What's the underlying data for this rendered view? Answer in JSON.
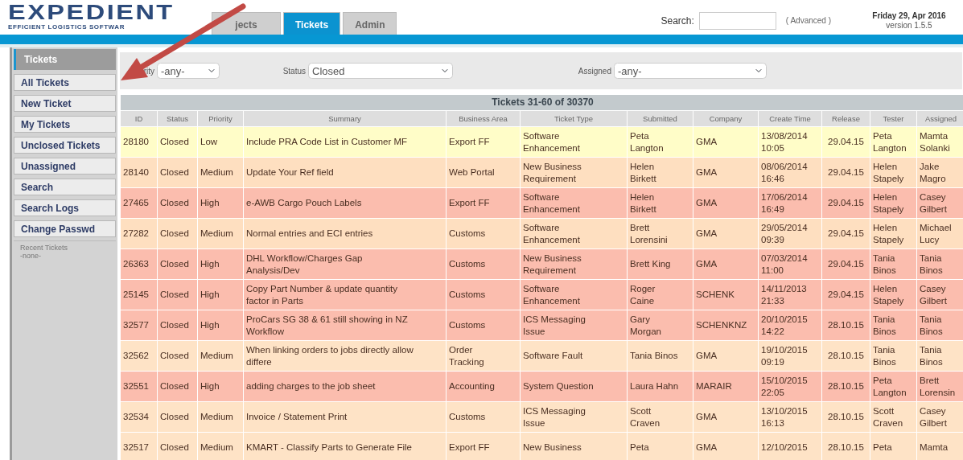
{
  "header": {
    "logo": "EXPEDIENT",
    "tagline": "EFFICIENT LOGISTICS SOFTWAR",
    "tabs": [
      {
        "label": "jects",
        "selected": false
      },
      {
        "label": "Tickets",
        "selected": true
      },
      {
        "label": "Admin",
        "selected": false
      }
    ],
    "search": {
      "label": "Search:",
      "advanced": "( Advanced )"
    },
    "date": "Friday 29, Apr 2016",
    "version": "version 1.5.5"
  },
  "sidebar": {
    "title": "Tickets",
    "items": [
      {
        "label": "All Tickets"
      },
      {
        "label": "New Ticket"
      },
      {
        "label": "My Tickets"
      },
      {
        "label": "Unclosed Tickets"
      },
      {
        "label": "Unassigned"
      },
      {
        "label": "Search"
      },
      {
        "label": "Search Logs"
      },
      {
        "label": "Change Passwd"
      }
    ],
    "recent_title": "Recent Tickets",
    "recent": "-none-"
  },
  "filters": [
    {
      "label": "rity",
      "value": "-any-"
    },
    {
      "label": "Status",
      "value": "Closed"
    },
    {
      "label": "Assigned",
      "value": "-any-"
    }
  ],
  "table": {
    "title": "Tickets 31-60 of 30370",
    "columns": [
      "ID",
      "Status",
      "Priority",
      "Summary",
      "Business Area",
      "Ticket Type",
      "Submitted",
      "Company",
      "Create Time",
      "Release",
      "Tester",
      "Assigned"
    ],
    "rows": [
      {
        "color": "#fffdc8",
        "cells": [
          "28180",
          "Closed",
          "Low",
          "Include PRA Code List in Customer MF",
          "Export FF",
          "Software\nEnhancement",
          "Peta\nLangton",
          "GMA",
          "13/08/2014\n10:05",
          "29.04.15",
          "Peta\nLangton",
          "Mamta\nSolanki"
        ]
      },
      {
        "color": "#fedfc0",
        "cells": [
          "28140",
          "Closed",
          "Medium",
          "Update Your Ref field",
          "Web Portal",
          "New Business\nRequirement",
          "Helen\nBirkett",
          "GMA",
          "08/06/2014\n16:46",
          "29.04.15",
          "Helen\nStapely",
          "Jake\nMagro"
        ]
      },
      {
        "color": "#fbbdae",
        "cells": [
          "27465",
          "Closed",
          "High",
          "e-AWB Cargo Pouch Labels",
          "Export FF",
          "Software\nEnhancement",
          "Helen\nBirkett",
          "GMA",
          "17/06/2014\n16:49",
          "29.04.15",
          "Helen\nStapely",
          "Casey\nGilbert"
        ]
      },
      {
        "color": "#fedfc0",
        "cells": [
          "27282",
          "Closed",
          "Medium",
          "Normal entries and ECI entries",
          "Customs",
          "Software\nEnhancement",
          "Brett\nLorensini",
          "GMA",
          "29/05/2014\n09:39",
          "29.04.15",
          "Helen\nStapely",
          "Michael\nLucy"
        ]
      },
      {
        "color": "#fbbdae",
        "cells": [
          "26363",
          "Closed",
          "High",
          "DHL Workflow/Charges Gap\nAnalysis/Dev",
          "Customs",
          "New Business\nRequirement",
          "Brett King",
          "GMA",
          "07/03/2014\n11:00",
          "29.04.15",
          "Tania\nBinos",
          "Tania\nBinos"
        ]
      },
      {
        "color": "#fbbdae",
        "cells": [
          "25145",
          "Closed",
          "High",
          "Copy Part Number & update quantity\nfactor in Parts",
          "Customs",
          "Software\nEnhancement",
          "Roger\nCaine",
          "SCHENK",
          "14/11/2013\n21:33",
          "29.04.15",
          "Helen\nStapely",
          "Casey\nGilbert"
        ]
      },
      {
        "color": "#fbbdae",
        "cells": [
          "32577",
          "Closed",
          "High",
          "ProCars SG 38 & 61 still showing in NZ\nWorkflow",
          "Customs",
          "ICS Messaging\nIssue",
          "Gary\nMorgan",
          "SCHENKNZ",
          "20/10/2015\n14:22",
          "28.10.15",
          "Tania\nBinos",
          "Tania\nBinos"
        ]
      },
      {
        "color": "#fee3c6",
        "cells": [
          "32562",
          "Closed",
          "Medium",
          "When linking orders to jobs directly allow\ndiffere",
          "Order\nTracking",
          "Software Fault",
          "Tania Binos",
          "GMA",
          "19/10/2015\n09:19",
          "28.10.15",
          "Tania\nBinos",
          "Tania\nBinos"
        ]
      },
      {
        "color": "#fbbdae",
        "cells": [
          "32551",
          "Closed",
          "High",
          "adding charges to the job sheet",
          "Accounting",
          "System Question",
          "Laura Hahn",
          "MARAIR",
          "15/10/2015\n22:05",
          "28.10.15",
          "Peta\nLangton",
          "Brett\nLorensin"
        ]
      },
      {
        "color": "#fee3c6",
        "cells": [
          "32534",
          "Closed",
          "Medium",
          "Invoice / Statement Print",
          "Customs",
          "ICS Messaging\nIssue",
          "Scott\nCraven",
          "GMA",
          "13/10/2015\n16:13",
          "28.10.15",
          "Scott\nCraven",
          "Casey\nGilbert"
        ]
      },
      {
        "color": "#fee3c6",
        "cells": [
          "32517",
          "Closed",
          "Medium",
          "KMART - Classify Parts to Generate File",
          "Export FF",
          "New Business",
          "Peta",
          "GMA",
          "12/10/2015",
          "28.10.15",
          "Peta",
          "Mamta"
        ]
      }
    ]
  }
}
